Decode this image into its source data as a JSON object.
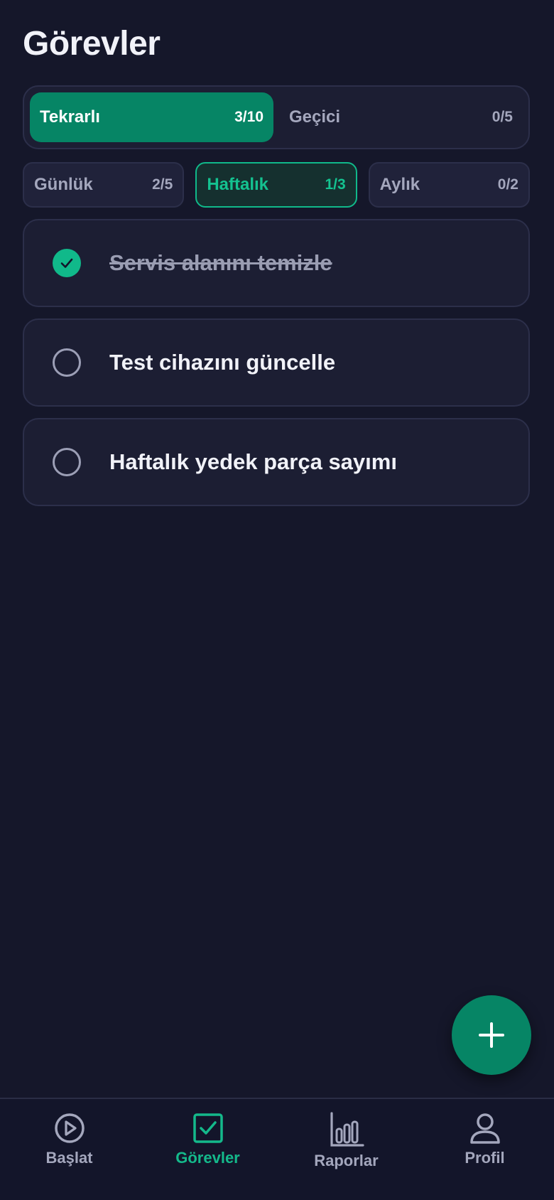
{
  "page": {
    "title": "Görevler"
  },
  "main_tabs": [
    {
      "label": "Tekrarlı",
      "count": "3/10",
      "active": true
    },
    {
      "label": "Geçici",
      "count": "0/5",
      "active": false
    }
  ],
  "period_tabs": [
    {
      "label": "Günlük",
      "count": "2/5",
      "active": false
    },
    {
      "label": "Haftalık",
      "count": "1/3",
      "active": true
    },
    {
      "label": "Aylık",
      "count": "0/2",
      "active": false
    }
  ],
  "tasks": [
    {
      "title": "Servis alanını temizle",
      "done": true
    },
    {
      "title": "Test cihazını güncelle",
      "done": false
    },
    {
      "title": "Haftalık yedek parça sayımı",
      "done": false
    }
  ],
  "fab": {
    "icon": "plus-icon"
  },
  "bottom_nav": [
    {
      "label": "Başlat",
      "icon": "play-circle-icon",
      "active": false
    },
    {
      "label": "Görevler",
      "icon": "checkbox-icon",
      "active": true
    },
    {
      "label": "Raporlar",
      "icon": "bar-chart-icon",
      "active": false
    },
    {
      "label": "Profil",
      "icon": "user-icon",
      "active": false
    }
  ],
  "colors": {
    "background": "#15172a",
    "accent": "#068565",
    "accent_bright": "#10b98a",
    "card": "#1c1e33",
    "muted_text": "#a4a7bd"
  }
}
